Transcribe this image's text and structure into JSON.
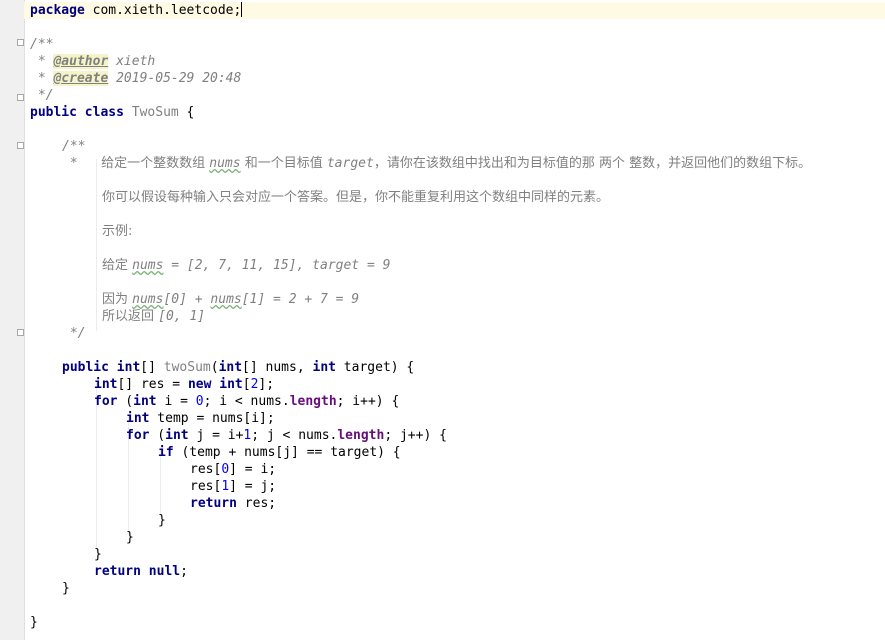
{
  "editor": {
    "package_kw": "package",
    "package_name": " com.xieth.leetcode;",
    "doc1_open": "/**",
    "doc1_star_a": " * ",
    "author_tag": "@author",
    "author_value": " xieth",
    "doc1_star_b": " * ",
    "create_tag": "@create",
    "create_value": " 2019-05-29 20:48",
    "doc1_close": " */",
    "class_kw1": "public",
    "class_kw2": "class",
    "class_name": "TwoSum",
    "class_open": " {",
    "doc2_open": "/**",
    "doc2_star": " *   ",
    "desc_a": "给定一个整数数组 ",
    "desc_nums": "nums",
    "desc_b": " 和一个目标值 ",
    "desc_target": "target",
    "desc_c": "，请你在该数组中找出和为目标值的那 两个 整数，并返回他们的数组下标。",
    "desc2": "你可以假设每种输入只会对应一个答案。但是，你不能重复利用这个数组中同样的元素。",
    "example_label": "示例:",
    "given_label": "给定 ",
    "given_nums": "nums",
    "given_rest": " = [2, 7, 11, 15], target = 9",
    "because_label": "因为 ",
    "because_nums0": "nums",
    "because_mid": "[0] + ",
    "because_nums1": "nums",
    "because_rest": "[1] = 2 + 7 = 9",
    "return_label": "所以返回 ",
    "return_value": "[0, 1]",
    "doc2_close": " */",
    "m_public": "public",
    "m_int": "int",
    "m_after_type": "[] ",
    "m_name": "twoSum",
    "m_paren": "(",
    "m_int2": "int",
    "m_param1": "[] nums, ",
    "m_int3": "int",
    "m_param2": " target) {",
    "l1_int": "int",
    "l1_a": "[] res = ",
    "l1_new": "new",
    "l1_b": " ",
    "l1_int2": "int",
    "l1_c": "[",
    "l1_num": "2",
    "l1_d": "];",
    "f1_for": "for",
    "f1_a": " (",
    "f1_int": "int",
    "f1_b": " i = ",
    "f1_zero": "0",
    "f1_c": "; i < nums.",
    "f1_length": "length",
    "f1_d": "; i++) {",
    "t_int": "int",
    "t_rest": " temp = nums[i];",
    "f2_for": "for",
    "f2_a": " (",
    "f2_int": "int",
    "f2_b": " j = i+",
    "f2_one": "1",
    "f2_c": "; j < nums.",
    "f2_length": "length",
    "f2_d": "; j++) {",
    "if_kw": "if",
    "if_rest": " (temp + nums[j] == target) {",
    "r0_a": "res[",
    "r0_num": "0",
    "r0_b": "] = i;",
    "r1_a": "res[",
    "r1_num": "1",
    "r1_b": "] = j;",
    "ret_kw": "return",
    "ret_rest": " res;",
    "brace": "}",
    "retnull_kw": "return",
    "retnull_sp": " ",
    "retnull_null": "null",
    "retnull_semi": ";"
  }
}
